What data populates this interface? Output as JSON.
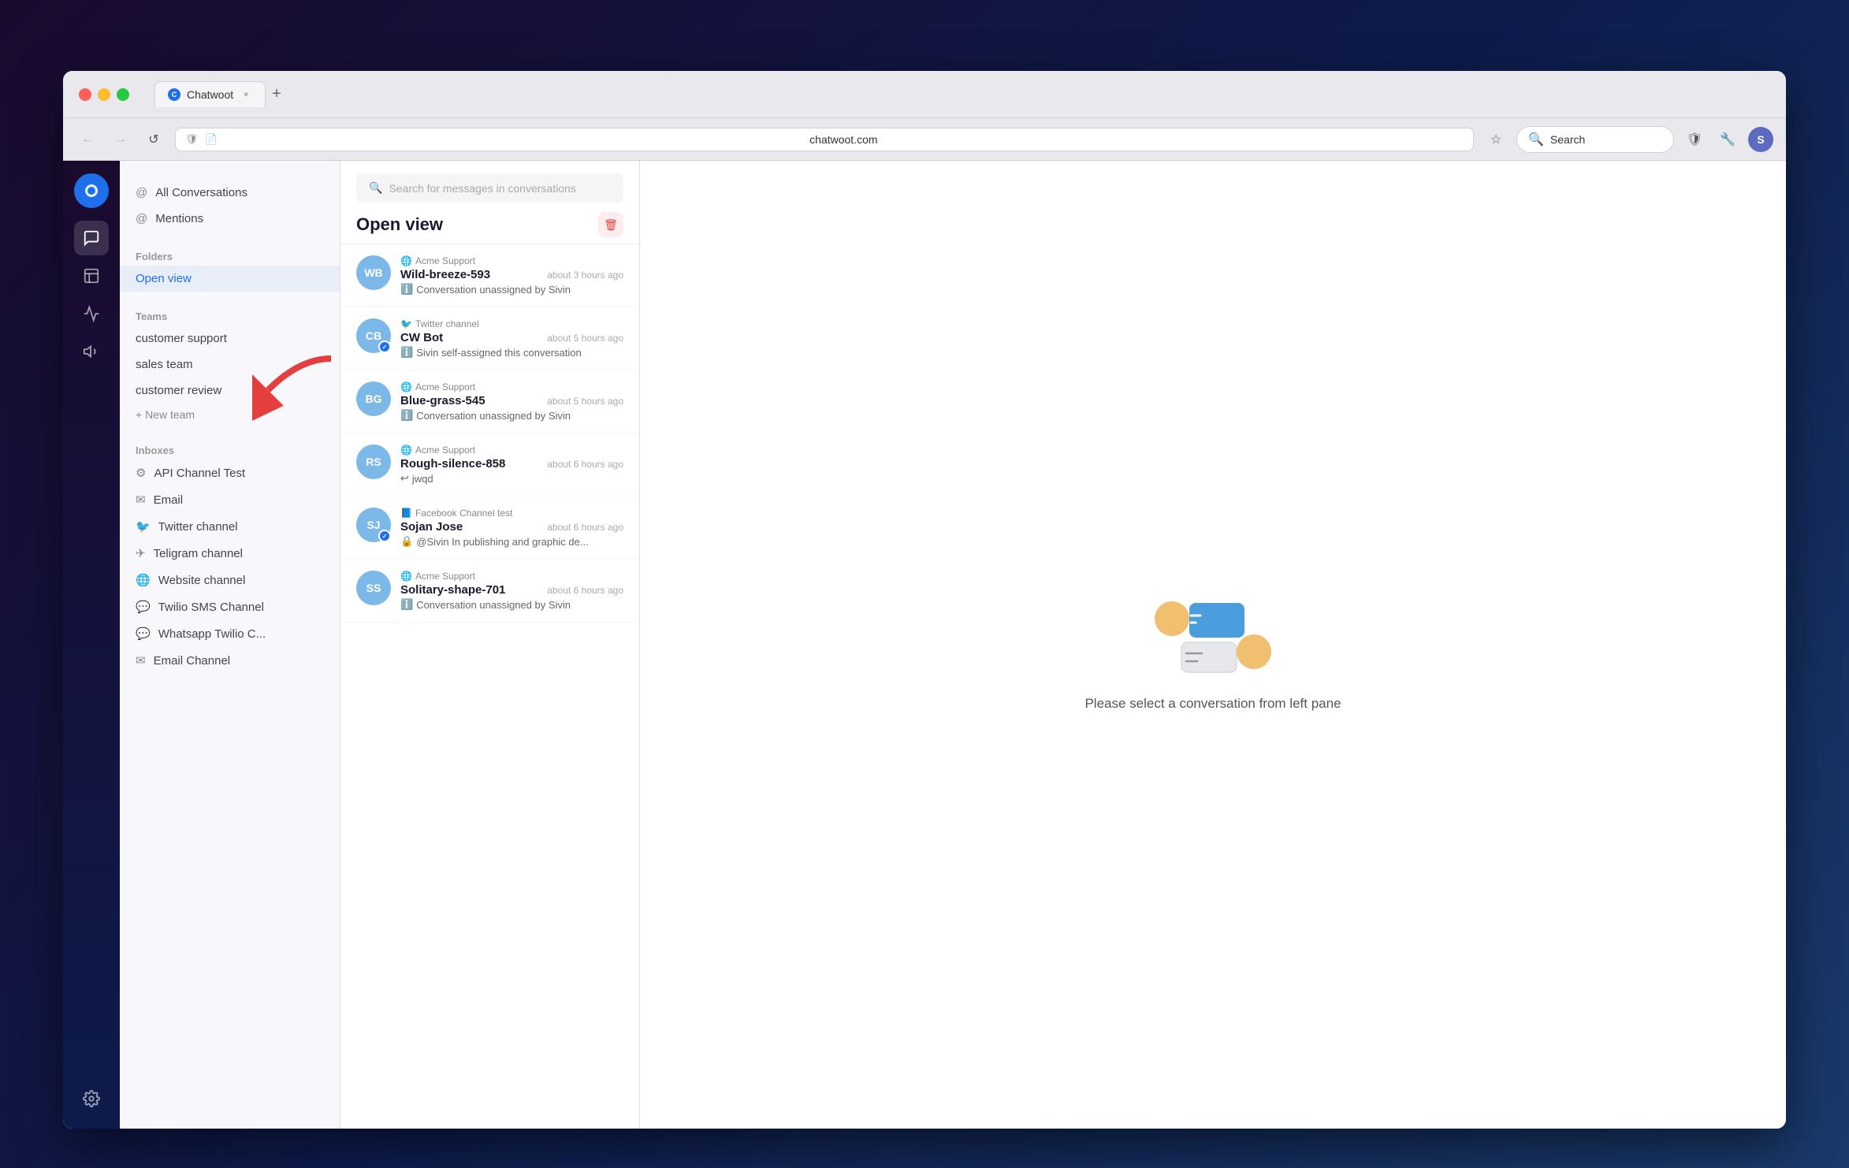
{
  "window": {
    "title": "Chatwoot",
    "tab_close": "×",
    "tab_new": "+"
  },
  "browser": {
    "back_btn": "←",
    "forward_btn": "→",
    "refresh_btn": "↺",
    "address": "chatwoot.com",
    "star_icon": "☆",
    "search_placeholder": "Search",
    "profile_initial": "S"
  },
  "icon_nav": {
    "logo": "C",
    "items": [
      {
        "name": "conversations",
        "icon": "💬"
      },
      {
        "name": "contacts",
        "icon": "👤"
      },
      {
        "name": "reports",
        "icon": "📈"
      },
      {
        "name": "campaigns",
        "icon": "📣"
      },
      {
        "name": "settings",
        "icon": "⚙️"
      }
    ]
  },
  "sidebar": {
    "all_conversations_label": "All Conversations",
    "mentions_label": "Mentions",
    "folders_header": "Folders",
    "open_view_label": "Open view",
    "teams_header": "Teams",
    "teams": [
      {
        "label": "customer support"
      },
      {
        "label": "sales team"
      },
      {
        "label": "customer review"
      }
    ],
    "new_team_label": "+ New team",
    "inboxes_header": "Inboxes",
    "inboxes": [
      {
        "label": "API Channel Test",
        "icon": "api"
      },
      {
        "label": "Email",
        "icon": "email"
      },
      {
        "label": "Twitter channel",
        "icon": "twitter"
      },
      {
        "label": "Teligram channel",
        "icon": "telegram"
      },
      {
        "label": "Website channel",
        "icon": "website"
      },
      {
        "label": "Twilio SMS Channel",
        "icon": "sms"
      },
      {
        "label": "Whatsapp Twilio C...",
        "icon": "whatsapp"
      },
      {
        "label": "Email Channel",
        "icon": "email"
      }
    ]
  },
  "conv_list": {
    "search_placeholder": "Search for messages in conversations",
    "title": "Open view",
    "delete_icon": "🗑",
    "conversations": [
      {
        "id": "conv1",
        "initials": "WB",
        "avatar_bg": "#7cb9e8",
        "source": "Acme Support",
        "source_icon": "🌐",
        "name": "Wild-breeze-593",
        "time": "about 3 hours ago",
        "preview": "Conversation unassigned by Sivin",
        "preview_icon": "ℹ️",
        "badge_color": null
      },
      {
        "id": "conv2",
        "initials": "CB",
        "avatar_bg": "#7cb9e8",
        "source": "Twitter channel",
        "source_icon": "🐦",
        "name": "CW Bot",
        "time": "about 5 hours ago",
        "preview": "Sivin self-assigned this conversation",
        "preview_icon": "ℹ️",
        "badge_color": "#1f6feb"
      },
      {
        "id": "conv3",
        "initials": "BG",
        "avatar_bg": "#7cb9e8",
        "source": "Acme Support",
        "source_icon": "🌐",
        "name": "Blue-grass-545",
        "time": "about 5 hours ago",
        "preview": "Conversation unassigned by Sivin",
        "preview_icon": "ℹ️",
        "badge_color": null
      },
      {
        "id": "conv4",
        "initials": "RS",
        "avatar_bg": "#7cb9e8",
        "source": "Acme Support",
        "source_icon": "🌐",
        "name": "Rough-silence-858",
        "time": "about 6 hours ago",
        "preview": "jwqd",
        "preview_icon": "↩",
        "badge_color": null
      },
      {
        "id": "conv5",
        "initials": "SJ",
        "avatar_bg": "#7cb9e8",
        "source": "Facebook Channel test",
        "source_icon": "📘",
        "name": "Sojan Jose",
        "time": "about 6 hours ago",
        "preview": "@Sivin In publishing and graphic de...",
        "preview_icon": "🔒",
        "badge_color": "#1f6feb"
      },
      {
        "id": "conv6",
        "initials": "SS",
        "avatar_bg": "#7cb9e8",
        "source": "Acme Support",
        "source_icon": "🌐",
        "name": "Solitary-shape-701",
        "time": "about 6 hours ago",
        "preview": "Conversation unassigned by Sivin",
        "preview_icon": "ℹ️",
        "badge_color": null
      }
    ]
  },
  "main": {
    "empty_text": "Please select a conversation from left pane"
  }
}
